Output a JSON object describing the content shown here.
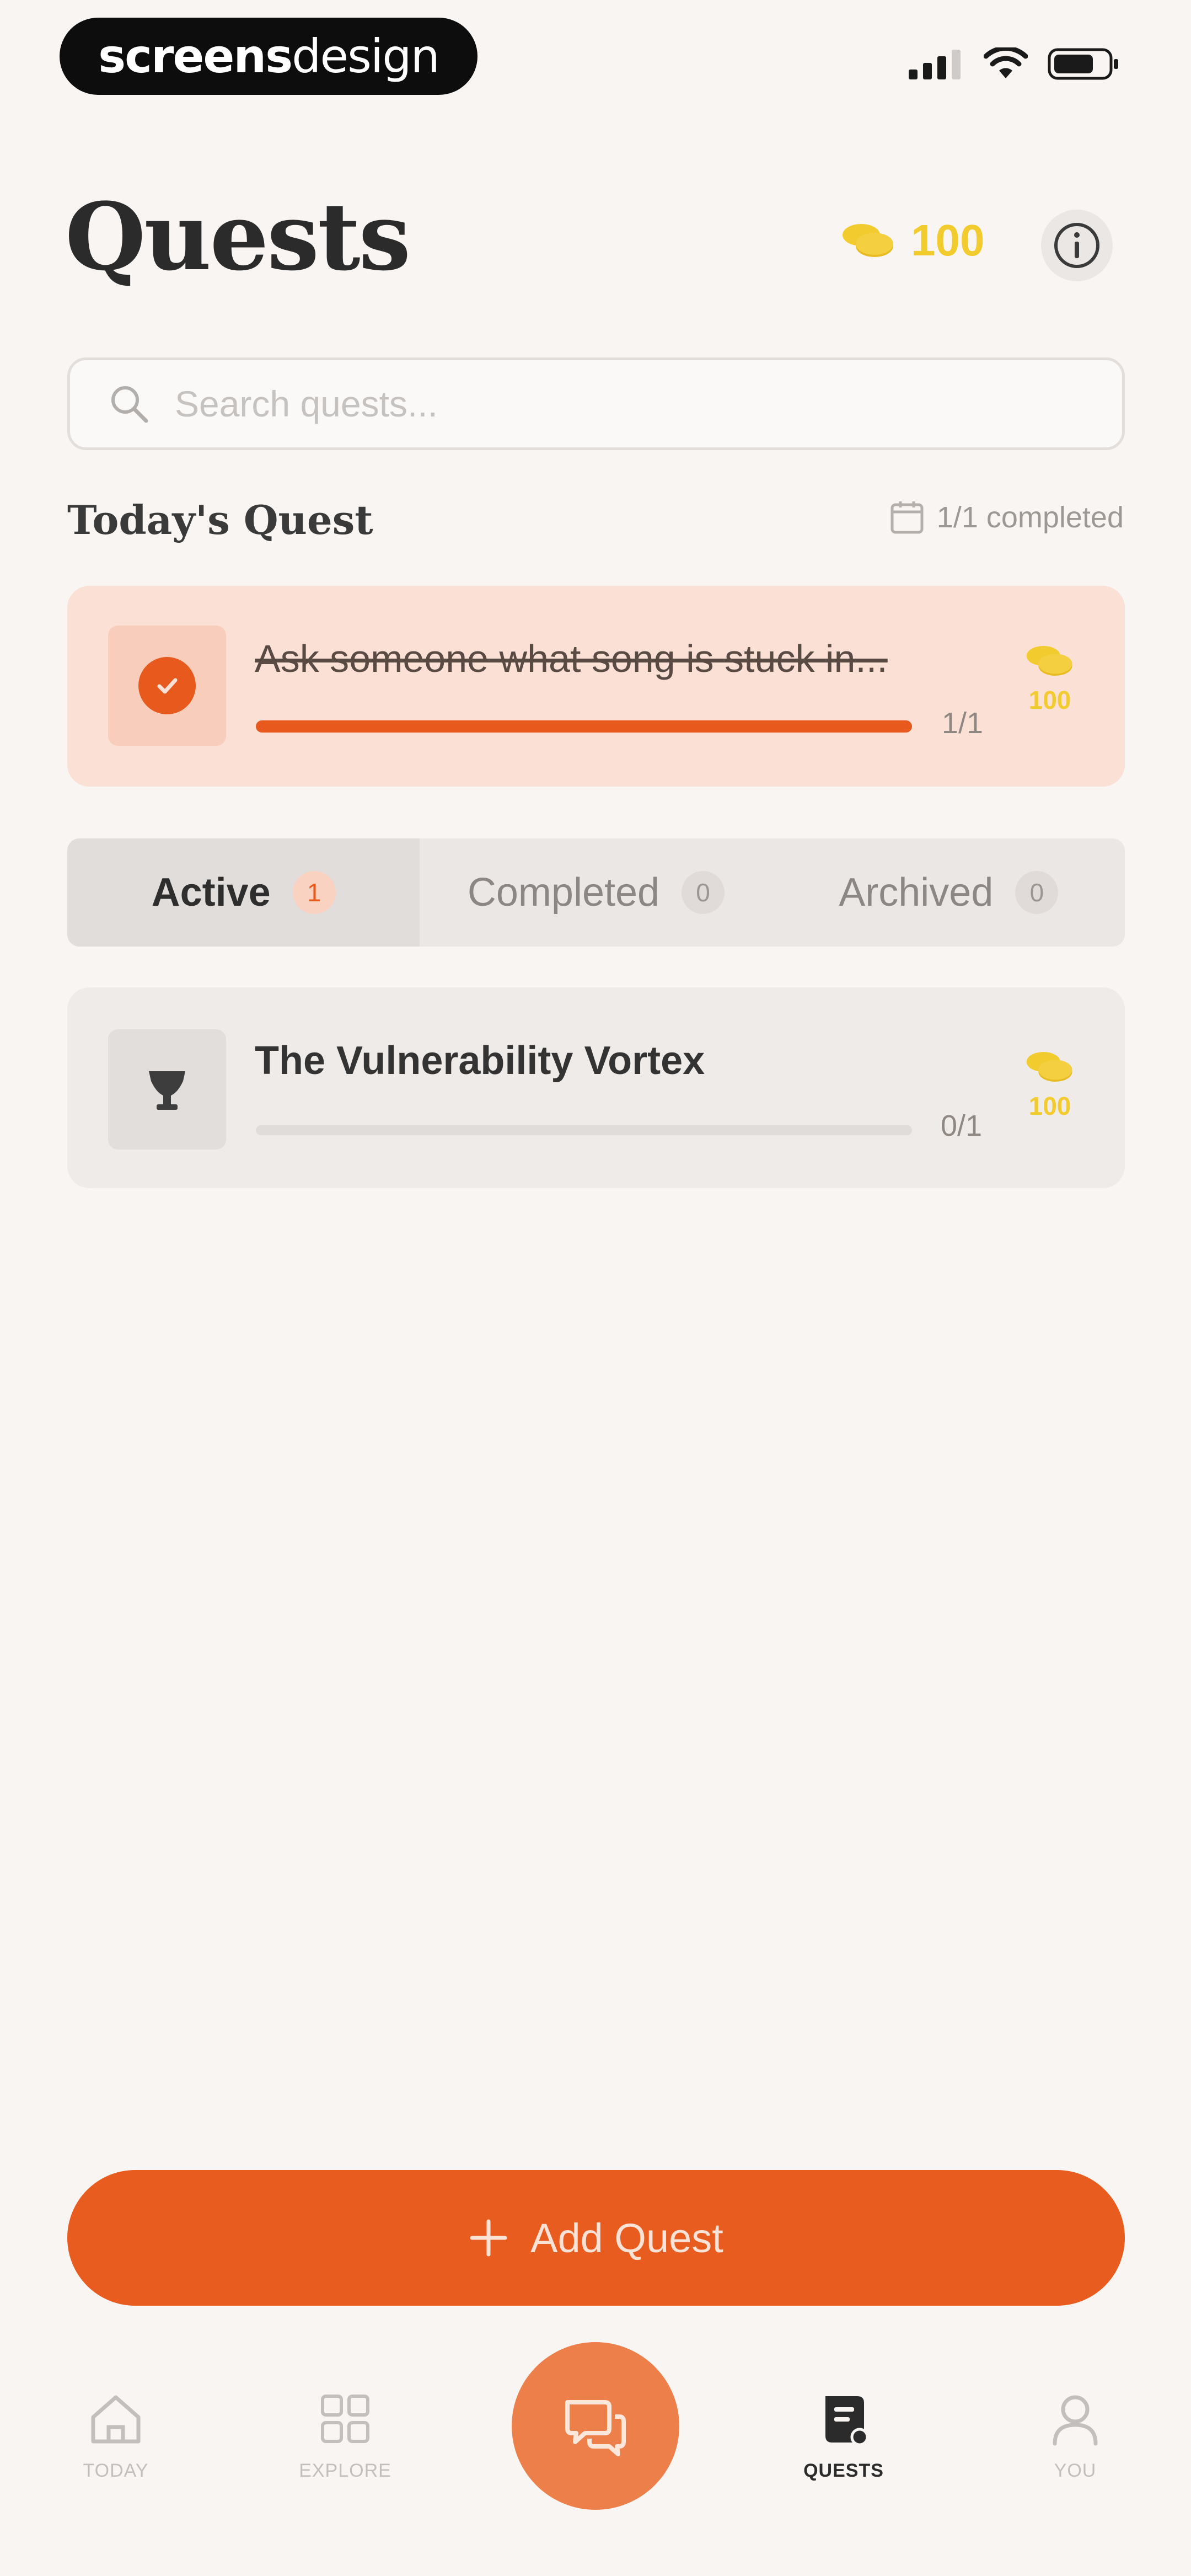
{
  "status_bar": {
    "brand_bold": "screens",
    "brand_light": "design"
  },
  "header": {
    "title": "Quests",
    "coins": "100"
  },
  "search": {
    "placeholder": "Search quests..."
  },
  "today": {
    "section_title": "Today's Quest",
    "completed_label": "1/1 completed",
    "quest": {
      "title": "Ask someone what song is stuck in...",
      "progress_text": "1/1",
      "progress_fraction": 1.0,
      "reward": "100"
    }
  },
  "tabs": [
    {
      "label": "Active",
      "count": "1"
    },
    {
      "label": "Completed",
      "count": "0"
    },
    {
      "label": "Archived",
      "count": "0"
    }
  ],
  "quests": [
    {
      "title": "The Vulnerability Vortex",
      "progress_text": "0/1",
      "progress_fraction": 0.0,
      "reward": "100"
    }
  ],
  "add_button": {
    "label": "Add Quest"
  },
  "nav": {
    "today": "TODAY",
    "explore": "EXPLORE",
    "quests": "QUESTS",
    "you": "YOU"
  },
  "colors": {
    "accent": "#e85d1f",
    "coin": "#f2cb2f",
    "today_card_bg": "#fbe0d5"
  }
}
